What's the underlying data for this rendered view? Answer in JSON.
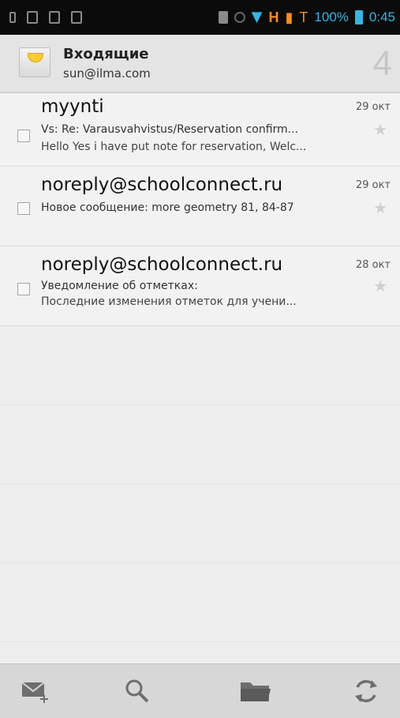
{
  "statusbar": {
    "network_label": "H",
    "battery_text": "100%",
    "clock": "0:45"
  },
  "header": {
    "title": "Входящие",
    "account": "sun@ilma.com",
    "unread_count": "4"
  },
  "messages": [
    {
      "from": "myynti",
      "date": "29 окт",
      "subject": "Vs: Re: Varausvahvistus/Reservation confirm...",
      "snippet": "Hello Yes i have put note for reservation, Welc..."
    },
    {
      "from": "noreply@schoolconnect.ru",
      "date": "29 окт",
      "subject": "Новое сообщение: more geometry 81, 84-87",
      "snippet": ""
    },
    {
      "from": "noreply@schoolconnect.ru",
      "date": "28 окт",
      "subject": "Уведомление об отметках:",
      "snippet": "Последние изменения отметок для учени..."
    }
  ],
  "bottombar": {
    "icons": [
      "compose-icon",
      "search-icon",
      "folder-icon",
      "refresh-icon"
    ]
  },
  "colors": {
    "accent": "#33b5e5",
    "status_orange": "#ff8c1a",
    "background": "#efefef"
  }
}
